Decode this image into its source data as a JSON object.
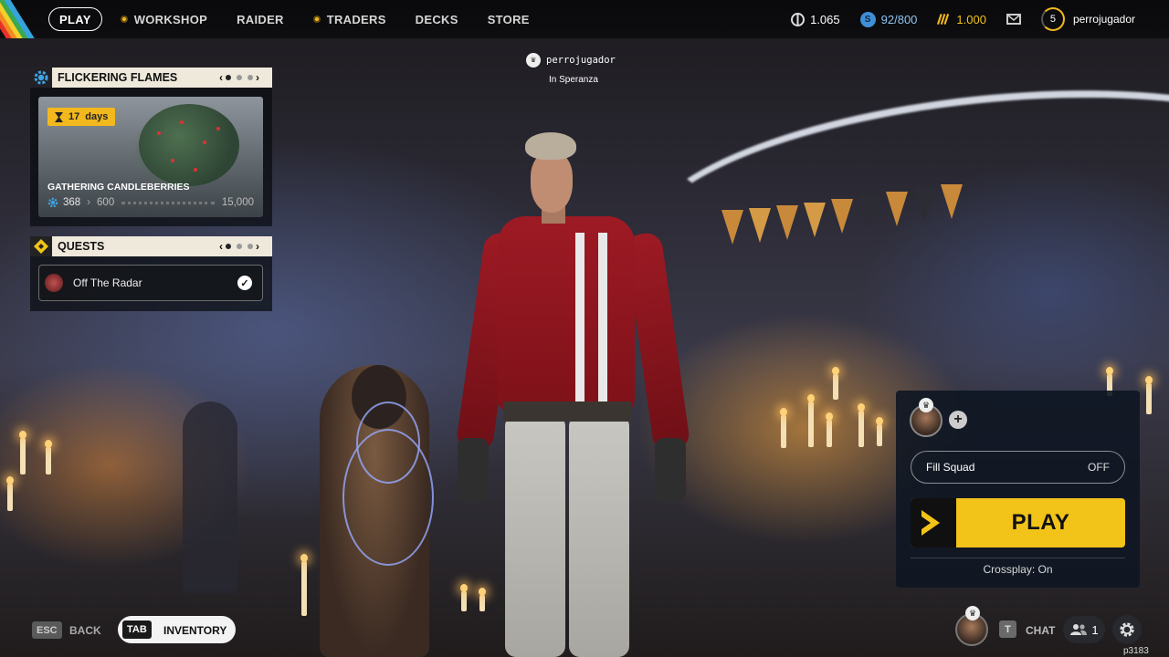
{
  "nav": {
    "items": [
      {
        "label": "PLAY",
        "badge": false,
        "active": true
      },
      {
        "label": "WORKSHOP",
        "badge": true,
        "active": false
      },
      {
        "label": "RAIDER",
        "badge": false,
        "active": false
      },
      {
        "label": "TRADERS",
        "badge": true,
        "active": false
      },
      {
        "label": "DECKS",
        "badge": false,
        "active": false
      },
      {
        "label": "STORE",
        "badge": false,
        "active": false
      }
    ]
  },
  "currencies": {
    "coins": "1.065",
    "seeds": "92/800",
    "credits": "1.000"
  },
  "profile": {
    "level": "5",
    "username": "perrojugador"
  },
  "event": {
    "title": "FLICKERING FLAMES",
    "timer_value": "17",
    "timer_unit": "days",
    "name": "GATHERING CANDLEBERRIES",
    "progress_current": "368",
    "progress_next": "600",
    "progress_max": "15,000",
    "page": 1,
    "page_count": 3
  },
  "quests": {
    "title": "QUESTS",
    "items": [
      {
        "label": "Off The Radar",
        "completed": true
      }
    ],
    "page": 1,
    "page_count": 3
  },
  "player_tag": {
    "name": "perrojugador",
    "location": "In Speranza"
  },
  "squad": {
    "fill_label": "Fill Squad",
    "fill_value": "OFF",
    "play_label": "PLAY",
    "crossplay": "Crossplay: On"
  },
  "bottom": {
    "back_key": "ESC",
    "back_label": "BACK",
    "inventory_key": "TAB",
    "inventory_label": "INVENTORY",
    "chat_key": "T",
    "chat_label": "CHAT",
    "friends_count": "1",
    "build": "p3183"
  },
  "colors": {
    "accent": "#f2c318",
    "panel_header": "#efe9dc",
    "squad_panel": "#0e1622"
  },
  "icons": {
    "event": "gear-icon",
    "quests": "diamond-quest-icon",
    "coins": "coin-icon",
    "seeds": "seed-icon",
    "credits": "credits-icon",
    "mail": "mail-icon",
    "settings": "gear-icon",
    "friends": "friends-icon"
  }
}
